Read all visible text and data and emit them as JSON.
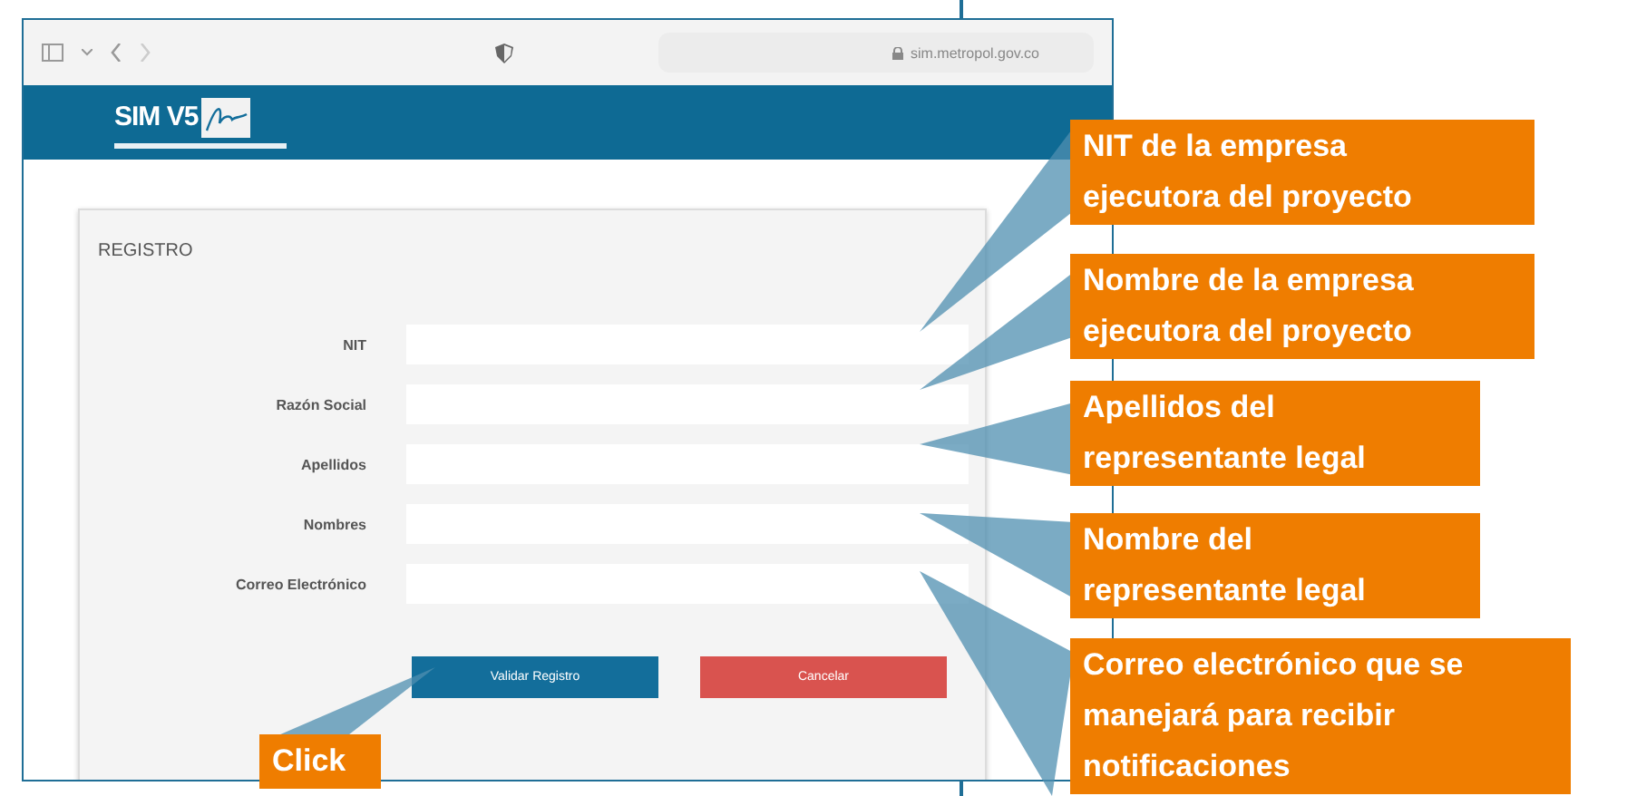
{
  "browser": {
    "url": "sim.metropol.gov.co"
  },
  "header": {
    "logo_text": "SIM V5"
  },
  "form": {
    "title": "REGISTRO",
    "fields": [
      {
        "label": "NIT"
      },
      {
        "label": "Razón Social"
      },
      {
        "label": "Apellidos"
      },
      {
        "label": "Nombres"
      },
      {
        "label": "Correo Electrónico"
      }
    ],
    "buttons": [
      {
        "label": "Validar Registro",
        "kind": "primary"
      },
      {
        "label": "Cancelar",
        "kind": "danger"
      }
    ]
  },
  "callouts": [
    {
      "text": "Click"
    },
    {
      "text": "NIT de la empresa ejecutora del proyecto"
    },
    {
      "text": "Nombre de la empresa ejecutora del proyecto"
    },
    {
      "text": "Apellidos del representante legal"
    },
    {
      "text": "Nombre del representante legal"
    },
    {
      "text": "Correo electrónico que se manejará para recibir notificaciones"
    }
  ]
}
